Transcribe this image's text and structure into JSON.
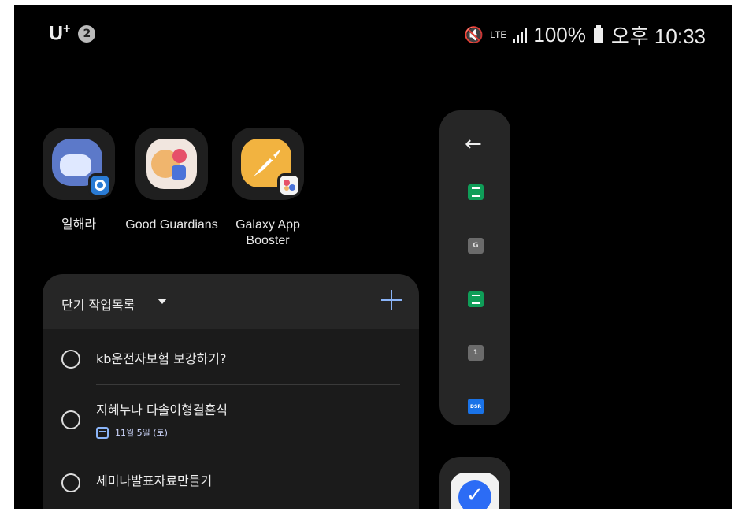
{
  "status_bar": {
    "carrier": "U",
    "carrier_sup": "+",
    "notification_count": "2",
    "network": "LTE",
    "battery": "100%",
    "time": "오후 10:33"
  },
  "apps": [
    {
      "label": "일해라"
    },
    {
      "label": "Good Guardians"
    },
    {
      "label": "Galaxy App Booster"
    }
  ],
  "widget": {
    "title": "단기 작업목록",
    "tasks": [
      {
        "text": "kb운전자보험 보강하기?"
      },
      {
        "text": "지혜누나 다솔이형결혼식",
        "due": "11월 5일 (토)"
      },
      {
        "text": "세미나발표자료만들기"
      }
    ]
  },
  "edge_panel": {
    "items": [
      {
        "icon": "sheets-icon"
      },
      {
        "icon": "g-icon",
        "label": "G"
      },
      {
        "icon": "sheets-icon"
      },
      {
        "icon": "number-icon",
        "label": "1"
      },
      {
        "icon": "dsr-icon",
        "label": "DSR"
      }
    ]
  },
  "colors": {
    "accent": "#8ab4f8",
    "background": "#000000",
    "widget": "#262626"
  }
}
